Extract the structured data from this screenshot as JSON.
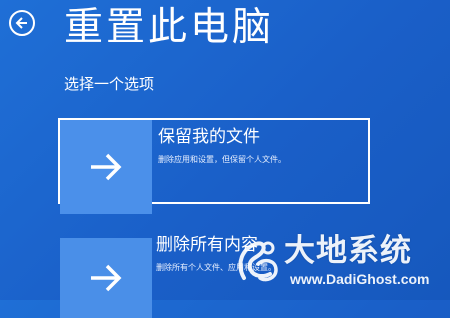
{
  "header": {
    "back_icon": "back-arrow-icon",
    "title": "重置此电脑",
    "subtitle": "选择一个选项"
  },
  "options": [
    {
      "icon": "arrow-right-icon",
      "title": "保留我的文件",
      "description": "删除应用和设置，但保留个人文件。",
      "selected": true
    },
    {
      "icon": "arrow-right-icon",
      "title": "删除所有内容",
      "description": "删除所有个人文件、应用和设置。",
      "selected": false
    }
  ],
  "watermark": {
    "name": "大地系统",
    "url": "www.DadiGhost.com"
  },
  "colors": {
    "background": "#1a5fc8",
    "tile": "#4b90ea",
    "text": "#ffffff"
  }
}
